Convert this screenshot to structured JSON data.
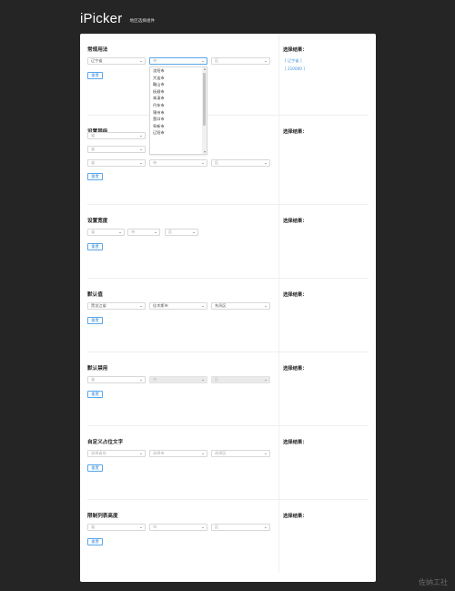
{
  "header": {
    "logo": "iPicker",
    "subtitle": "地区选择组件"
  },
  "sections": [
    {
      "title": "常规用法",
      "result_title": "选择结果：",
      "selects": [
        {
          "value": "辽宁省",
          "placeholder": false
        },
        {
          "value": "市",
          "placeholder": true
        },
        {
          "value": "区",
          "placeholder": true
        }
      ],
      "button": "重置",
      "results": [
        "[ 辽宁省 ]",
        "[ 210000 ]"
      ]
    },
    {
      "title": "设置层级",
      "result_title": "选择结果：",
      "selects": [
        {
          "value": "省",
          "placeholder": true
        },
        {
          "value": "省",
          "placeholder": true
        },
        {
          "value": "市",
          "placeholder": true
        },
        {
          "value": "省",
          "placeholder": true
        },
        {
          "value": "市",
          "placeholder": true
        },
        {
          "value": "区",
          "placeholder": true
        }
      ],
      "button": "重置"
    },
    {
      "title": "设置宽度",
      "result_title": "选择结果：",
      "selects": [
        {
          "value": "省",
          "placeholder": true
        },
        {
          "value": "市",
          "placeholder": true
        },
        {
          "value": "区",
          "placeholder": true
        }
      ],
      "button": "重置"
    },
    {
      "title": "默认值",
      "result_title": "选择结果：",
      "selects": [
        {
          "value": "黑龙江省",
          "placeholder": false
        },
        {
          "value": "佳木斯市",
          "placeholder": false
        },
        {
          "value": "东风区",
          "placeholder": false
        }
      ],
      "button": "重置"
    },
    {
      "title": "默认禁用",
      "result_title": "选择结果：",
      "selects": [
        {
          "value": "省",
          "placeholder": true
        },
        {
          "value": "市",
          "placeholder": true,
          "disabled": true
        },
        {
          "value": "区",
          "placeholder": true,
          "disabled": true
        }
      ],
      "button": "重置"
    },
    {
      "title": "自定义占位文字",
      "result_title": "选择结果：",
      "selects": [
        {
          "value": "选择省份",
          "placeholder": true
        },
        {
          "value": "选择市",
          "placeholder": true
        },
        {
          "value": "选择区",
          "placeholder": true
        }
      ],
      "button": "重置"
    },
    {
      "title": "限制列表高度",
      "result_title": "选择结果：",
      "selects": [
        {
          "value": "省",
          "placeholder": true
        },
        {
          "value": "市",
          "placeholder": true
        },
        {
          "value": "区",
          "placeholder": true
        }
      ],
      "button": "重置"
    }
  ],
  "dropdown": {
    "options": [
      "沈阳市",
      "大连市",
      "鞍山市",
      "抚顺市",
      "本溪市",
      "丹东市",
      "锦州市",
      "营口市",
      "阜新市",
      "辽阳市"
    ]
  },
  "watermark": "佐纳工社"
}
